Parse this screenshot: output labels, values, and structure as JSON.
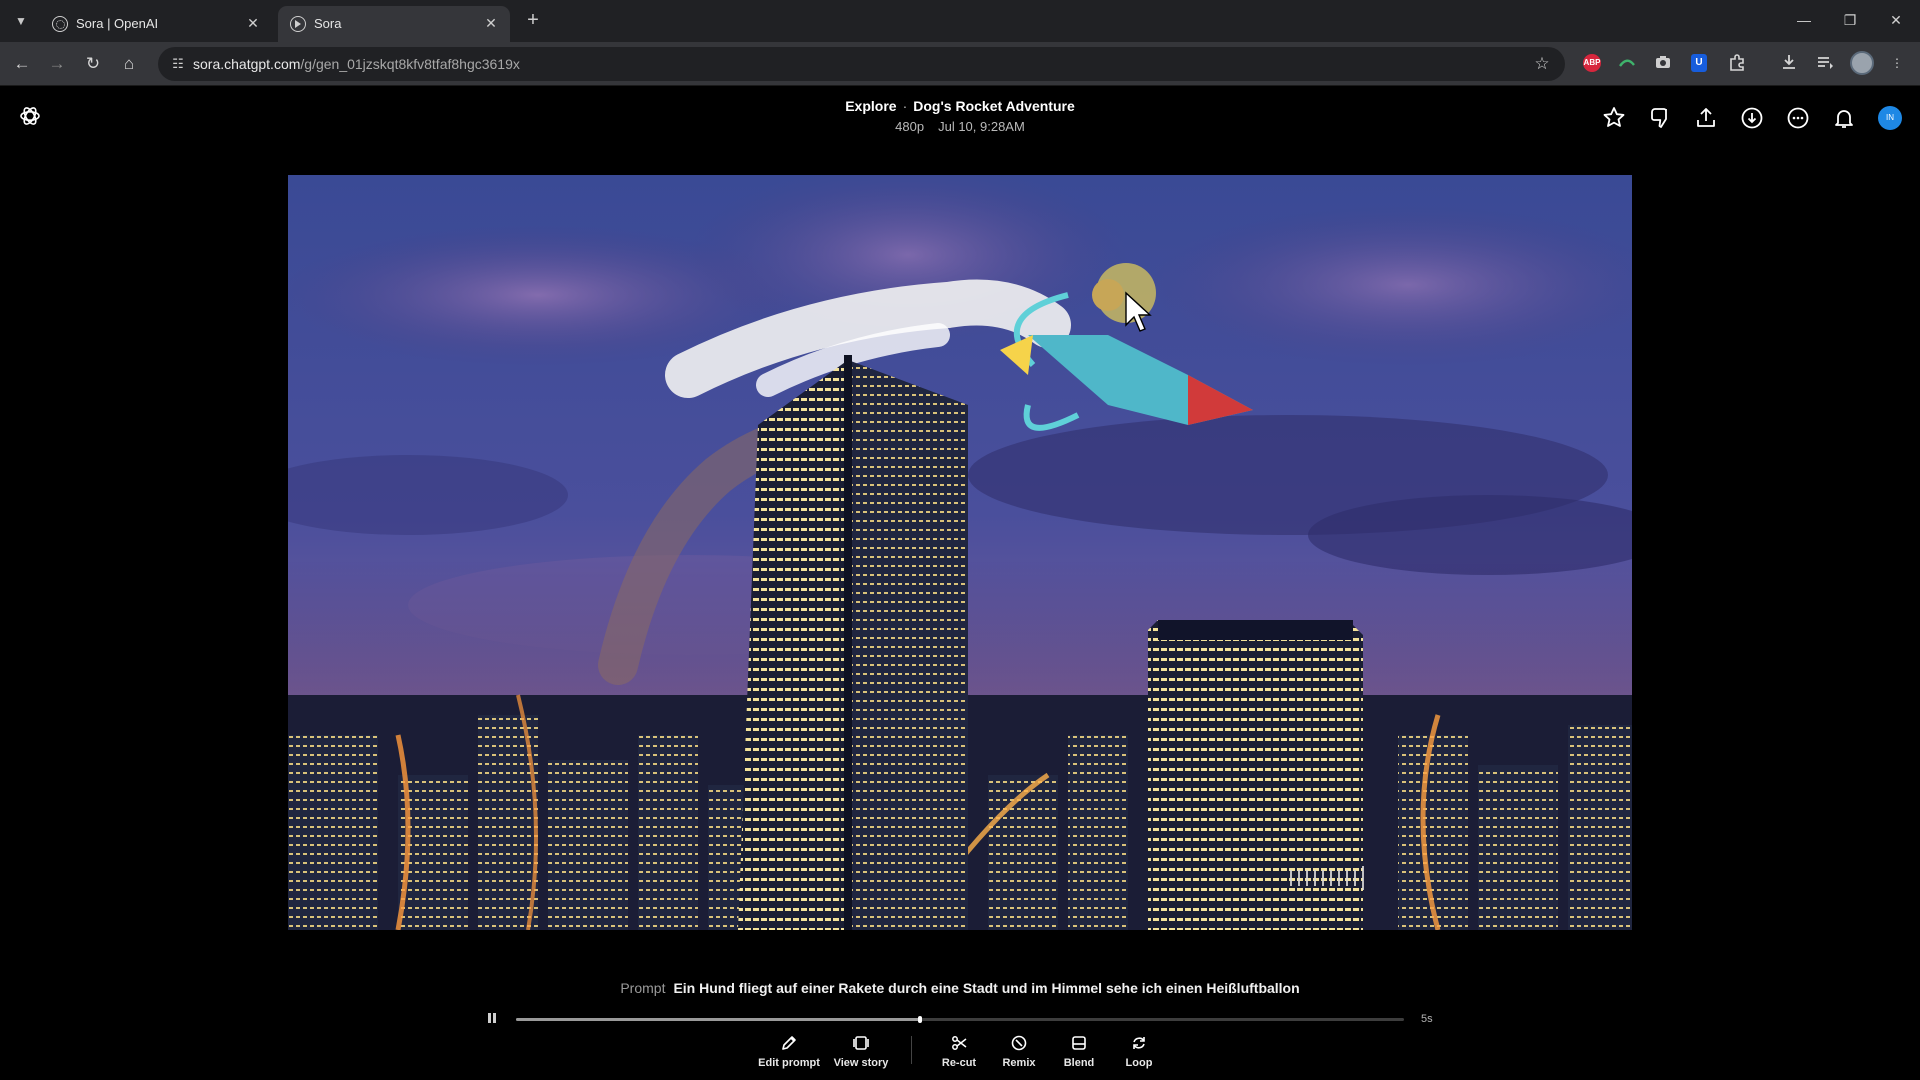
{
  "browser": {
    "tabs": [
      {
        "title": "Sora | OpenAI",
        "active": false
      },
      {
        "title": "Sora",
        "active": true
      }
    ],
    "url_host": "sora.chatgpt.com",
    "url_path": "/g/gen_01jzskqt8kfv8tfaf8hgc3619x",
    "extensions": [
      "adblock-plus-icon",
      "green-extension-icon",
      "camera-icon",
      "bitwarden-icon",
      "puzzle-extensions-icon"
    ],
    "abp_label": "ABP",
    "bitwarden_label": "U"
  },
  "header": {
    "breadcrumb_section": "Explore",
    "breadcrumb_separator": "·",
    "title": "Dog's Rocket Adventure",
    "resolution": "480p",
    "timestamp": "Jul 10, 9:28AM",
    "avatar_initials": "IN"
  },
  "player": {
    "prompt_label": "Prompt",
    "prompt_text": "Ein Hund fliegt auf einer Rakete durch eine Stadt und im Himmel sehe ich einen Heißluftballon",
    "progress": 0.455,
    "duration": "5s"
  },
  "actions": [
    {
      "label": "Edit prompt",
      "icon": "pencil-icon"
    },
    {
      "label": "View story",
      "icon": "storyboard-icon"
    },
    {
      "label": "Re-cut",
      "icon": "scissors-icon"
    },
    {
      "label": "Remix",
      "icon": "remix-icon"
    },
    {
      "label": "Blend",
      "icon": "blend-icon"
    },
    {
      "label": "Loop",
      "icon": "loop-icon"
    }
  ],
  "colors": {
    "background": "#000000",
    "tab_bar": "#202124",
    "toolbar": "#35363a",
    "avatar": "#1e88e5"
  }
}
